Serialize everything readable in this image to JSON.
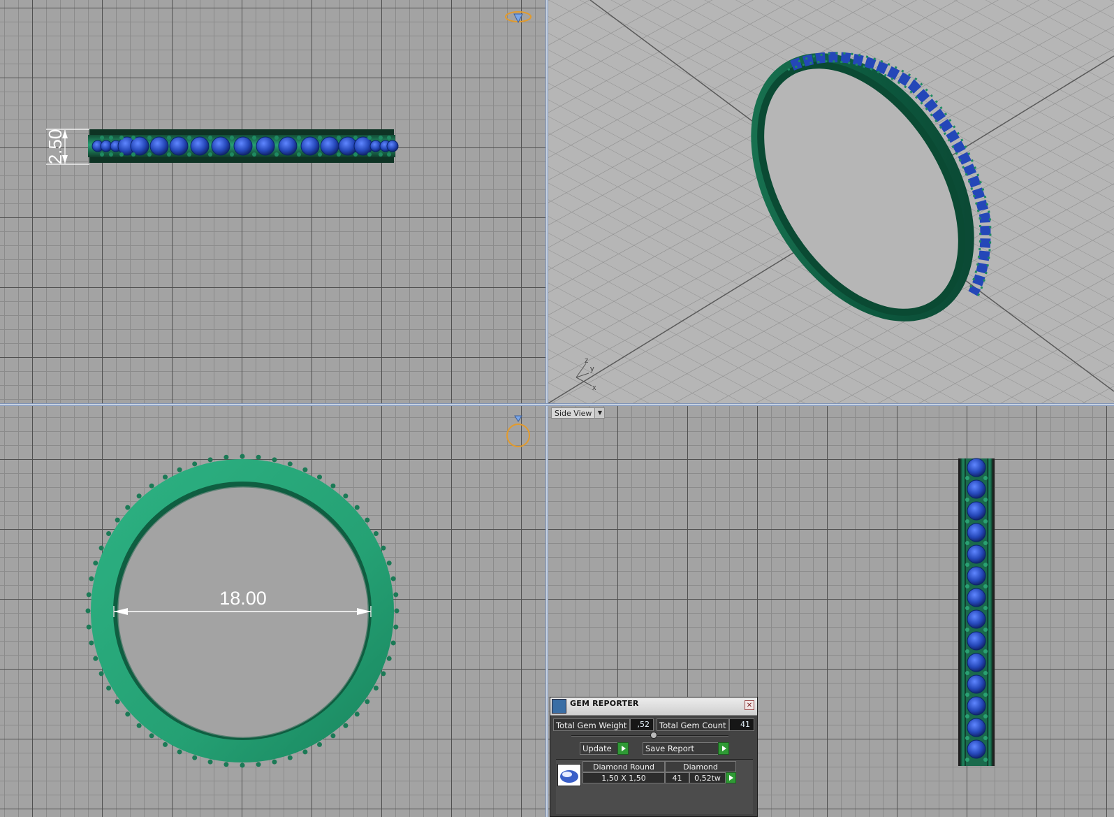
{
  "viewports": {
    "top": {
      "dimension": "2.50"
    },
    "front": {
      "dimension": "18.00"
    },
    "side": {
      "label": "Side View",
      "dropdown_glyph": "▼"
    },
    "perspective": {
      "axis_x": "x",
      "axis_y": "y",
      "axis_z": "z"
    }
  },
  "gem_reporter": {
    "title": "GEM REPORTER",
    "close_glyph": "✕",
    "total_weight_label": "Total Gem Weight",
    "total_weight_value": ",52",
    "total_count_label": "Total Gem Count",
    "total_count_value": "41",
    "update_label": "Update",
    "save_label": "Save Report",
    "rows": [
      {
        "shape": "Diamond Round",
        "material": "Diamond",
        "size": "1,50 X 1,50",
        "count": "41",
        "weight": "0,52tw"
      }
    ]
  },
  "colors": {
    "metal": "#1f8a62",
    "gem": "#2346b0",
    "grid_bg": "#a3a3a3",
    "panel_bg": "#434343",
    "accent_go": "#2f9a35"
  }
}
